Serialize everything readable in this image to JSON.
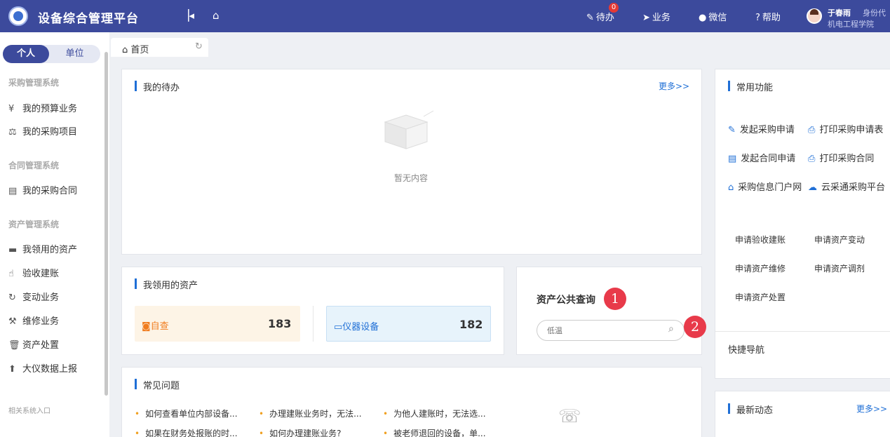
{
  "header": {
    "app_title": "设备综合管理平台",
    "collapse_icon": "collapse-left-icon",
    "home_icon": "home-icon",
    "nav": [
      {
        "label": "待办",
        "icon": "edit-icon",
        "badge": "0"
      },
      {
        "label": "业务",
        "icon": "paper-plane-icon"
      },
      {
        "label": "微信",
        "icon": "wechat-icon"
      },
      {
        "label": "帮助",
        "icon": "help-icon"
      }
    ],
    "user": {
      "name": "于春雨",
      "role": "身份代",
      "dept": "机电工程学院"
    }
  },
  "sidebar": {
    "toggle": {
      "personal": "个人",
      "unit": "单位",
      "selected": "个人"
    },
    "sections": [
      {
        "title": "采购管理系统",
        "items": [
          {
            "label": "我的预算业务",
            "icon": "yen-icon"
          },
          {
            "label": "我的采购项目",
            "icon": "scale-icon"
          }
        ]
      },
      {
        "title": "合同管理系统",
        "items": [
          {
            "label": "我的采购合同",
            "icon": "contract-icon"
          }
        ]
      },
      {
        "title": "资产管理系统",
        "items": [
          {
            "label": "我领用的资产",
            "icon": "laptop-icon"
          },
          {
            "label": "验收建账",
            "icon": "thumbs-up-icon"
          },
          {
            "label": "变动业务",
            "icon": "refresh-icon"
          },
          {
            "label": "维修业务",
            "icon": "wrench-icon"
          },
          {
            "label": "资产处置",
            "icon": "trash-icon"
          },
          {
            "label": "大仪数据上报",
            "icon": "upload-icon"
          }
        ]
      }
    ],
    "footer": "相关系统入口"
  },
  "tabs": [
    {
      "label": "首页",
      "icon": "home-icon",
      "refresh_icon": "refresh-icon"
    }
  ],
  "todo": {
    "title": "我的待办",
    "more": "更多>>",
    "empty": "暂无内容"
  },
  "assets": {
    "title": "我领用的资产",
    "stats": [
      {
        "label": "自查",
        "value": "183",
        "icon": "self-check-icon",
        "color": "#f07c1e"
      },
      {
        "label": "仪器设备",
        "value": "182",
        "icon": "monitor-icon",
        "color": "#1f6fd6"
      }
    ]
  },
  "asset_query": {
    "title": "资产公共查询",
    "placeholder": "低温",
    "marker1": "1",
    "marker2": "2"
  },
  "faq": {
    "title": "常见问题",
    "items": [
      "如何查看单位内部设备...",
      "办理建账业务时，无法...",
      "为他人建账时，无法选...",
      "如果在财务处报账的时...",
      "如何办理建账业务?",
      "被老师退回的设备，单..."
    ]
  },
  "common_functions": {
    "title": "常用功能",
    "items": [
      {
        "label": "发起采购申请",
        "icon": "pencil-icon"
      },
      {
        "label": "打印采购申请表",
        "icon": "printer-icon"
      },
      {
        "label": "发起合同申请",
        "icon": "clipboard-icon"
      },
      {
        "label": "打印采购合同",
        "icon": "printer-icon"
      },
      {
        "label": "采购信息门户网",
        "icon": "home-icon"
      },
      {
        "label": "云采通采购平台",
        "icon": "cloud-icon"
      }
    ],
    "apply": [
      "申请验收建账",
      "申请资产变动",
      "申请资产维修",
      "申请资产调剂",
      "申请资产处置"
    ]
  },
  "quick_nav": {
    "title": "快捷导航"
  },
  "news": {
    "title": "最新动态",
    "more": "更多>>"
  },
  "colors": {
    "primary": "#3c4a9c",
    "accent": "#1f6fd6",
    "marker": "#e83a4a"
  }
}
